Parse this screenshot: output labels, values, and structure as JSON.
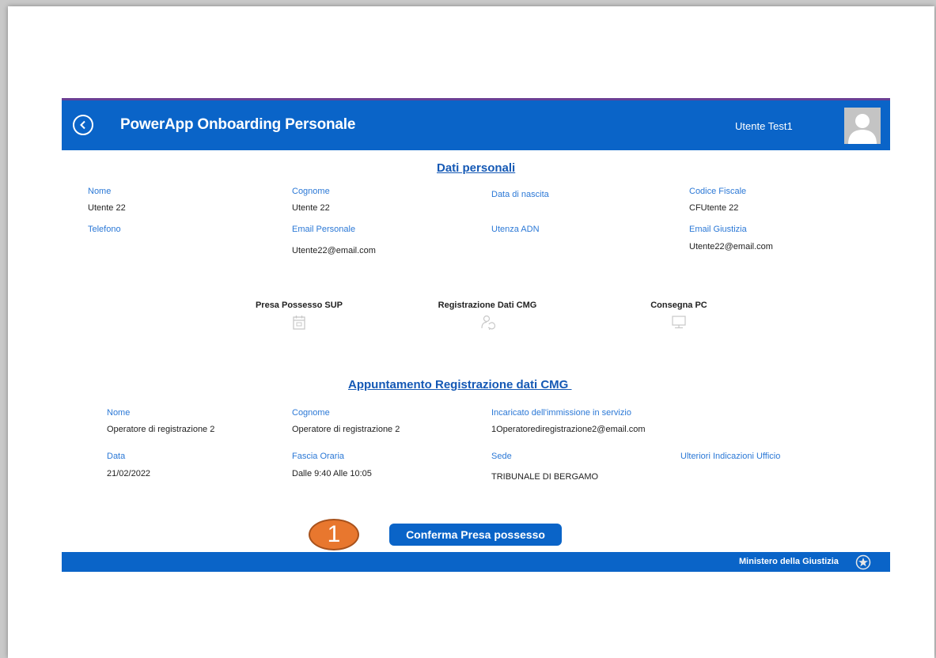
{
  "header": {
    "title": "PowerApp Onboarding Personale",
    "user_name": "Utente Test1"
  },
  "personal": {
    "section_title": "Dati personali",
    "fields": [
      {
        "label": "Nome",
        "value": "Utente 22"
      },
      {
        "label": "Cognome",
        "value": "Utente 22"
      },
      {
        "label": "Data di nascita",
        "value": ""
      },
      {
        "label": "Codice Fiscale",
        "value": "CFUtente 22"
      },
      {
        "label": "Telefono",
        "value": ""
      },
      {
        "label": "Email Personale",
        "value": "Utente22@email.com"
      },
      {
        "label": "Utenza ADN",
        "value": ""
      },
      {
        "label": "Email Giustizia",
        "value": "Utente22@email.com"
      }
    ]
  },
  "steps": [
    {
      "label": "Presa Possesso SUP",
      "icon": "calendar-icon"
    },
    {
      "label": "Registrazione Dati CMG",
      "icon": "person-sync-icon"
    },
    {
      "label": "Consegna PC",
      "icon": "computer-icon"
    }
  ],
  "appointment": {
    "section_title": "Appuntamento Registrazione dati CMG ",
    "fields": [
      {
        "label": "Nome",
        "value": "Operatore di registrazione 2"
      },
      {
        "label": "Cognome",
        "value": "Operatore di registrazione 2"
      },
      {
        "label": "Incaricato dell'immissione in servizio",
        "value": "1Operatorediregistrazione2@email.com"
      },
      {
        "label": "Data",
        "value": "21/02/2022"
      },
      {
        "label": "Fascia Oraria",
        "value": "Dalle 9:40 Alle 10:05"
      },
      {
        "label": "Sede",
        "value": "TRIBUNALE DI BERGAMO"
      },
      {
        "label": "Ulteriori Indicazioni Ufficio",
        "value": ""
      }
    ]
  },
  "actions": {
    "confirm_label": "Conferma Presa possesso",
    "callout_number": "1"
  },
  "footer": {
    "text": "Ministero della Giustizia"
  },
  "colors": {
    "brand_blue": "#0a64c8",
    "header_accent": "#6a3f94",
    "label_blue": "#2b78d6",
    "callout_orange": "#e8772e"
  }
}
